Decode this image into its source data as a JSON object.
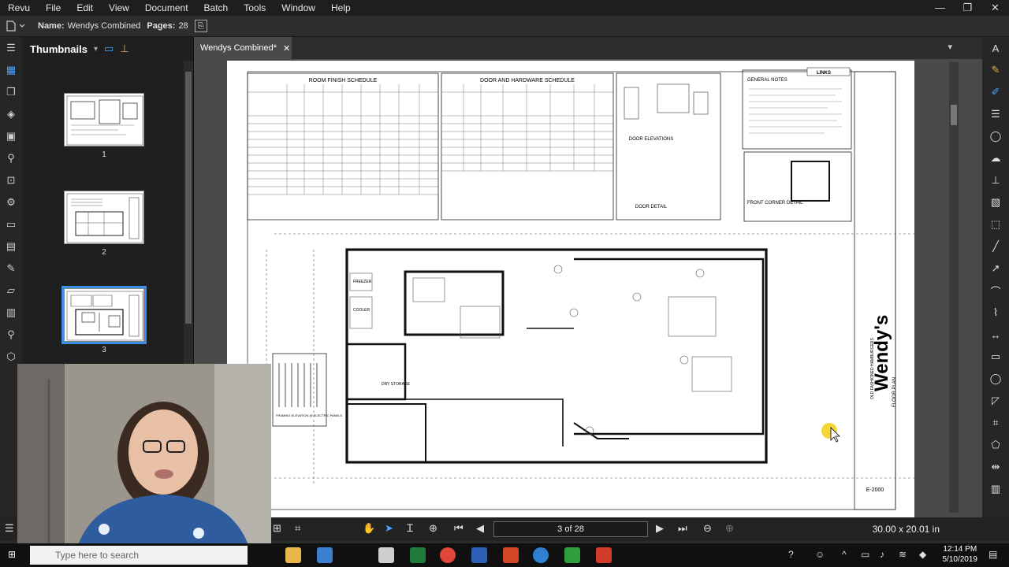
{
  "menubar": {
    "items": [
      "Revu",
      "File",
      "Edit",
      "View",
      "Document",
      "Batch",
      "Tools",
      "Window",
      "Help"
    ],
    "minimize": "—",
    "restore": "❐",
    "close": "✕"
  },
  "propbar": {
    "name_label": "Name:",
    "name_value": "Wendys Combined",
    "pages_label": "Pages:",
    "pages_value": "28"
  },
  "thumbnails": {
    "title": "Thumbnails",
    "pages": [
      {
        "num": "1"
      },
      {
        "num": "2"
      },
      {
        "num": "3"
      }
    ]
  },
  "document": {
    "tab_title": "Wendys Combined*",
    "close": "✕",
    "sheet": {
      "room_finish_title": "ROOM FINISH SCHEDULE",
      "door_hardware_title": "DOOR AND HARDWARE SCHEDULE",
      "door_elevations": "DOOR ELEVATIONS",
      "door_detail": "DOOR DETAIL",
      "general_notes": "GENERAL NOTES",
      "links": "LINKS",
      "front_corner_detail": "FRONT CORNER DETAIL",
      "framing_elevation": "FRAMING ELEVATION @ ELECTRIC PANELS",
      "brand": "Wendy's",
      "brand_sub": "OLD FASHIONED HAMBURGERS",
      "floor_plan": "FLOOR PLAN",
      "sheet_number": "E-2000",
      "freezer": "FREEZER",
      "cooler": "COOLER",
      "dry_storage": "DRY STORAGE"
    }
  },
  "statusbar": {
    "page_indicator": "3 of 28",
    "dimensions": "30.00 x 20.01 in"
  },
  "taskbar": {
    "search_placeholder": "Type here to search",
    "time": "12:14 PM",
    "date": "5/10/2019"
  },
  "colors": {
    "accent": "#3a8ee6",
    "menubar_bg": "#1e1e1e",
    "panel_bg": "#1f1f1f",
    "doc_bg": "#4a4a4a"
  },
  "icons": {
    "left_rail": [
      "thumbnails-icon",
      "bookmarks-icon",
      "layers-icon",
      "toolchest-icon",
      "properties-icon",
      "markups-icon",
      "settings-icon",
      "measure-icon",
      "forms-icon",
      "signatures-icon",
      "compare-icon",
      "sets-icon",
      "search-icon",
      "links-icon"
    ],
    "right_rail": [
      "text-icon",
      "highlight-icon",
      "pen-icon",
      "callout-icon",
      "shape-icon",
      "cloud-icon",
      "stamp-icon",
      "image-icon",
      "snapshot-icon",
      "line-icon",
      "arrow-icon",
      "arc-icon",
      "polyline-icon",
      "dimension-icon",
      "rectangle-icon",
      "ellipse-icon",
      "polygon-icon",
      "crop-icon",
      "area-icon",
      "count-icon",
      "calibrate-icon"
    ]
  }
}
